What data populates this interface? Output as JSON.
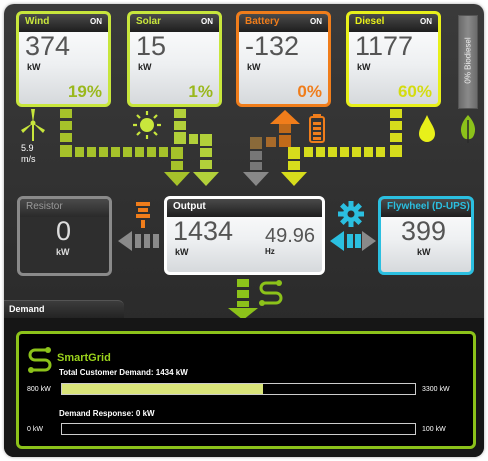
{
  "sources": {
    "wind": {
      "title": "Wind",
      "status": "ON",
      "value": "374",
      "unit": "kW",
      "percent": "19%",
      "speed": "5.9",
      "speed_unit": "m/s"
    },
    "solar": {
      "title": "Solar",
      "status": "ON",
      "value": "15",
      "unit": "kW",
      "percent": "1%"
    },
    "battery": {
      "title": "Battery",
      "status": "ON",
      "value": "-132",
      "unit": "kW",
      "percent": "0%"
    },
    "diesel": {
      "title": "Diesel",
      "status": "ON",
      "value": "1177",
      "unit": "kW",
      "percent": "60%"
    }
  },
  "biodiesel_gauge": {
    "label": "0% Biodiesel",
    "level": 0
  },
  "resistor": {
    "title": "Resistor",
    "value": "0",
    "unit": "kW"
  },
  "output": {
    "title": "Output",
    "value": "1434",
    "unit": "kW",
    "frequency": "49.96",
    "frequency_unit": "Hz"
  },
  "flywheel": {
    "title": "Flywheel (D-UPS)",
    "value": "399",
    "unit": "kW"
  },
  "demand": {
    "tab_label": "Demand",
    "smartgrid_title": "SmartGrid",
    "total_label": "Total Customer Demand: 1434 kW",
    "total_min": "800 kW",
    "total_max": "3300 kW",
    "total_fill": 0.57,
    "response_label": "Demand Response: 0 kW",
    "response_min": "0 kW",
    "response_max": "100 kW",
    "response_fill": 0
  },
  "colors": {
    "wind": "#c8e63c",
    "battery": "#f07d1b",
    "diesel": "#e8f01a",
    "flywheel": "#2bbfe0",
    "output": "#ffffff",
    "resistor": "#8a8a8a",
    "smartgrid": "#8cc21a"
  },
  "icons": [
    "wind-turbine-icon",
    "sun-icon",
    "battery-icon",
    "droplet-icon",
    "leaf-icon",
    "gear-icon",
    "smartgrid-icon",
    "arrow-icon"
  ]
}
